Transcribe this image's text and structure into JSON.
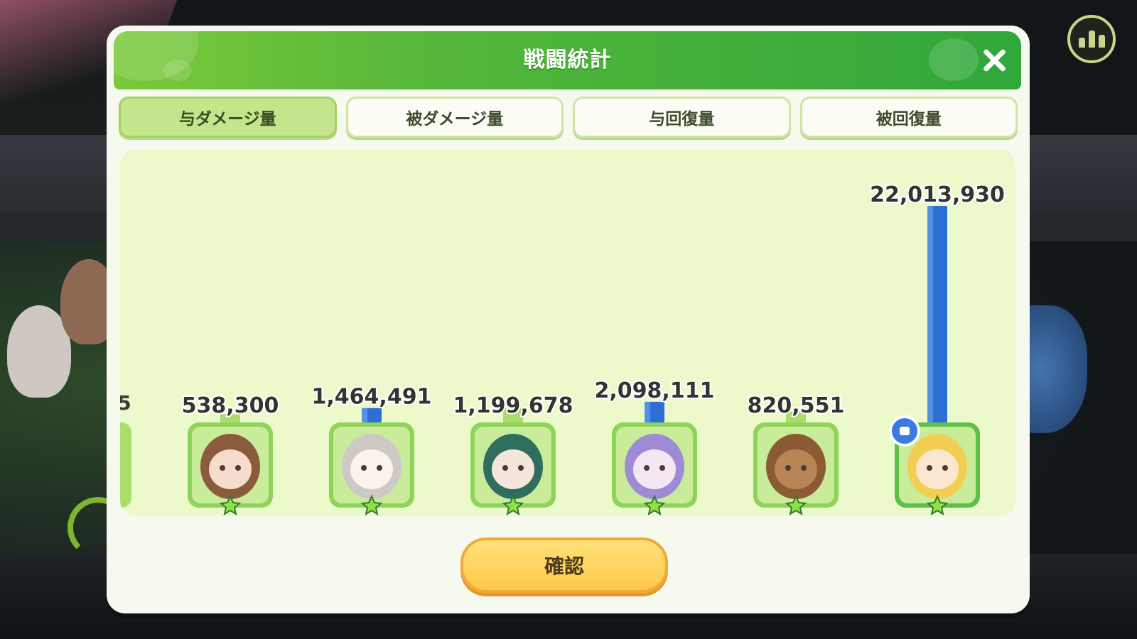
{
  "dialog": {
    "title": "戦闘統計",
    "tabs": [
      {
        "label": "与ダメージ量",
        "active": true
      },
      {
        "label": "被ダメージ量",
        "active": false
      },
      {
        "label": "与回復量",
        "active": false
      },
      {
        "label": "被回復量",
        "active": false
      }
    ],
    "confirm_label": "確認"
  },
  "colors": {
    "header_green": "#3aa63a",
    "bar_blue": "#2e6fd6",
    "tab_active": "#c3e68c",
    "chart_bg": "#ecfacb",
    "confirm_yellow": "#ffd45c"
  },
  "chart_data": {
    "type": "bar",
    "title": "",
    "metric": "与ダメージ量",
    "partial_left_label": "5",
    "units": [
      {
        "value": 538300,
        "label": "538,300",
        "portrait": "brown-hair-girl-headband",
        "mvp": false
      },
      {
        "value": 1464491,
        "label": "1,464,491",
        "portrait": "grey-hair-fanged-girl",
        "mvp": false
      },
      {
        "value": 1199678,
        "label": "1,199,678",
        "portrait": "green-hair-glasses-elf",
        "mvp": false
      },
      {
        "value": 2098111,
        "label": "2,098,111",
        "portrait": "purple-hair-skull-hat-girl",
        "mvp": false
      },
      {
        "value": 820551,
        "label": "820,551",
        "portrait": "wooden-golem",
        "mvp": false
      },
      {
        "value": 22013930,
        "label": "22,013,930",
        "portrait": "blonde-crying-girl",
        "mvp": true
      }
    ],
    "ylim": [
      0,
      22013930
    ],
    "grid": false,
    "legend": "none"
  },
  "icons": {
    "stats": "bar-chart-icon",
    "close": "close-icon",
    "mvp": "thumbs-up-icon",
    "star": "star-icon"
  }
}
